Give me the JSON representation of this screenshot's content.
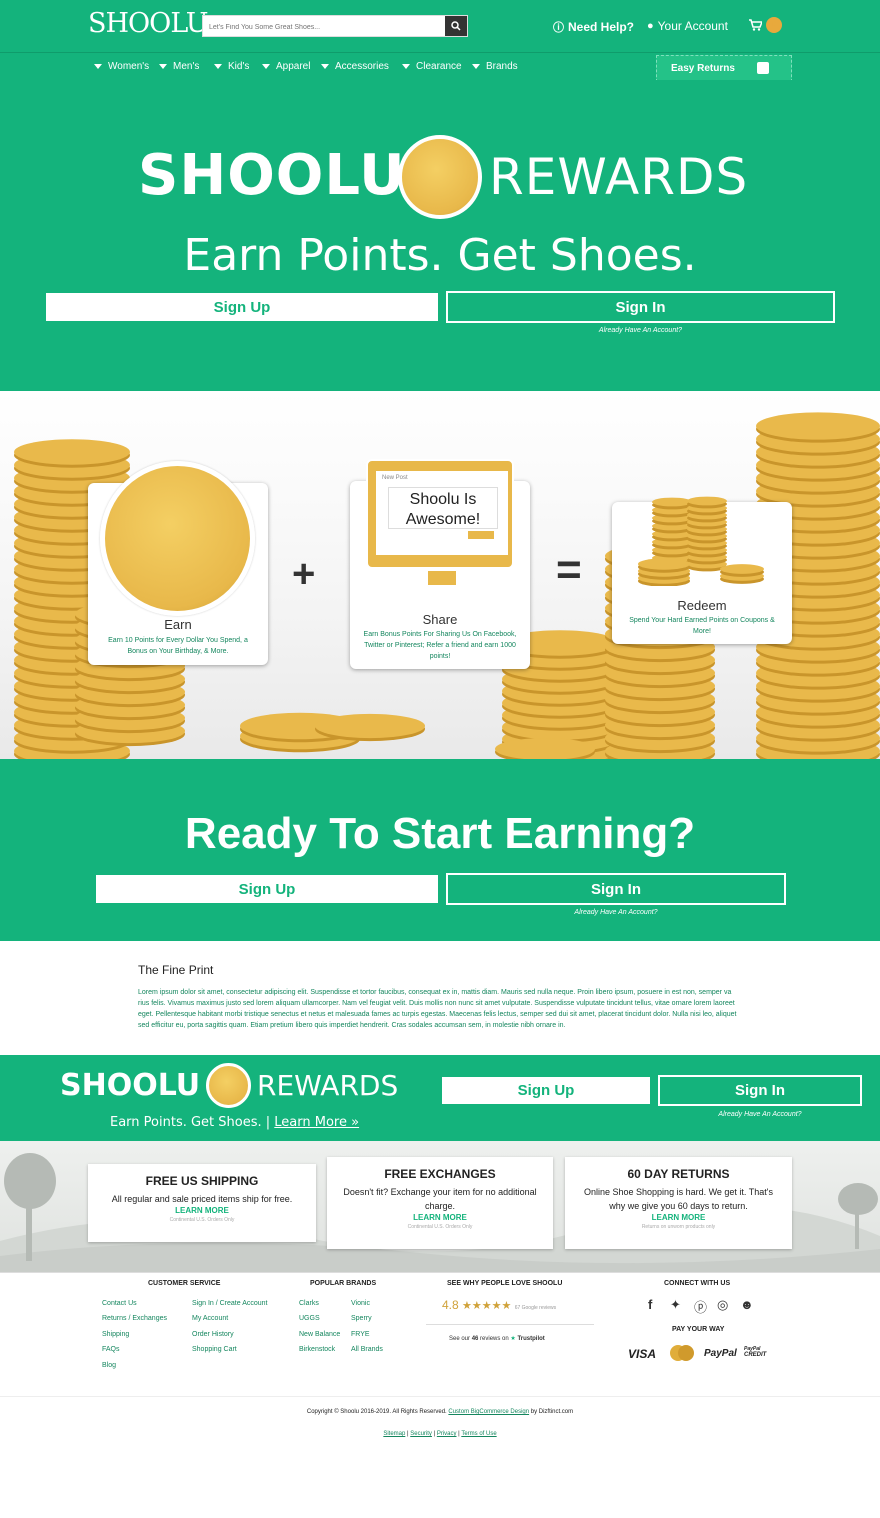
{
  "header": {
    "logo": "SHOOLU",
    "search_placeholder": "Let's Find You Some Great Shoes...",
    "need_help": "Need Help?",
    "your_account": "Your Account",
    "cart_count": "0"
  },
  "nav": {
    "items": [
      "Women's",
      "Men's",
      "Kid's",
      "Apparel",
      "Accessories",
      "Clearance",
      "Brands"
    ],
    "easy_returns": "Easy Returns"
  },
  "hero": {
    "brand_left": "SHOOLU",
    "brand_right": "REWARDS",
    "tagline": "Earn Points. Get Shoes.",
    "sign_up": "Sign Up",
    "sign_in": "Sign In",
    "already": "Already Have An Account?"
  },
  "steps": {
    "earn_title": "Earn",
    "earn_text": "Earn 10 Points for Every Dollar You Spend, a Bonus on Your Birthday, & More.",
    "share_post_label": "New Post",
    "share_post_text": "Shoolu Is Awesome!",
    "share_title": "Share",
    "share_text": "Earn Bonus Points For Sharing Us On Facebook, Twitter or Pinterest; Refer a friend and earn 1000 points!",
    "redeem_title": "Redeem",
    "redeem_text": "Spend Your Hard Earned Points on Coupons & More!",
    "plus": "+",
    "equals": "="
  },
  "ready": {
    "heading": "Ready To Start Earning?",
    "sign_up": "Sign Up",
    "sign_in": "Sign In",
    "already": "Already Have An Account?"
  },
  "fine_print": {
    "heading": "The Fine Print",
    "body": "Lorem ipsum dolor sit amet, consectetur adipiscing elit. Suspendisse et tortor faucibus, consequat ex in, mattis diam. Mauris sed nulla neque. Proin libero ipsum, posuere in est non, semper va rius felis. Vivamus maximus justo sed lorem aliquam ullamcorper. Nam vel feugiat velit. Duis mollis non nunc sit amet vulputate. Suspendisse vulputate tincidunt tellus, vitae ornare lorem laoreet eget. Pellentesque habitant morbi tristique senectus et netus et malesuada fames ac turpis egestas. Maecenas felis lectus, semper sed dui sit amet, placerat tincidunt dolor. Nulla nisi leo, aliquet sed efficitur eu, porta sagittis quam. Etiam pretium libero quis imperdiet hendrerit. Cras sodales accumsan sem, in molestie nibh ornare in."
  },
  "banner": {
    "brand_left": "SHOOLU",
    "brand_right": "REWARDS",
    "tagline": "Earn Points. Get Shoes. |",
    "learn_more": "Learn More »",
    "sign_up": "Sign Up",
    "sign_in": "Sign In",
    "already": "Already Have An Account?"
  },
  "features": [
    {
      "title": "FREE US SHIPPING",
      "text": "All regular and sale priced items ship for free.",
      "link": "LEARN MORE",
      "note": "Continental U.S. Orders Only"
    },
    {
      "title": "FREE EXCHANGES",
      "text": "Doesn't fit? Exchange your item for no additional charge.",
      "link": "LEARN MORE",
      "note": "Continental U.S. Orders Only"
    },
    {
      "title": "60 DAY RETURNS",
      "text": "Online Shoe Shopping is hard. We get it. That's why we give you 60 days to return.",
      "link": "LEARN MORE",
      "note": "Returns on unworn products only"
    }
  ],
  "footer": {
    "customer_service": "CUSTOMER SERVICE",
    "cs_col1": [
      "Contact Us",
      "Returns / Exchanges",
      "Shipping",
      "FAQs",
      "Blog"
    ],
    "cs_col2": [
      "Sign In / Create Account",
      "My Account",
      "Order History",
      "Shopping Cart"
    ],
    "popular_brands": "POPULAR BRANDS",
    "pb_col1": [
      "Clarks",
      "UGGS",
      "New Balance",
      "Birkenstock"
    ],
    "pb_col2": [
      "Vionic",
      "Sperry",
      "FRYE",
      "All Brands"
    ],
    "reviews_head": "SEE WHY PEOPLE LOVE SHOOLU",
    "rating": "4.8",
    "stars": "★★★★★",
    "google_reviews": "67 Google reviews",
    "trustpilot_prefix": "See our",
    "trustpilot_count": "46",
    "trustpilot_suffix": "reviews on",
    "trustpilot": "Trustpilot",
    "connect": "CONNECT WITH US",
    "pay": "PAY YOUR WAY",
    "visa": "VISA",
    "paypal": "PayPal",
    "credit_line1": "PayPal",
    "credit_line2": "CREDIT",
    "copyright": "Copyright © Shoolu 2016-2019. All Rights Reserved.",
    "custom_design": "Custom BigCommerce Design",
    "by": "by Dizftinct.com",
    "legal": [
      "Sitemap",
      "Security",
      "Privacy",
      "Terms of Use"
    ]
  },
  "colors": {
    "brand_green": "#14b37c",
    "gold": "#e8b84a"
  }
}
